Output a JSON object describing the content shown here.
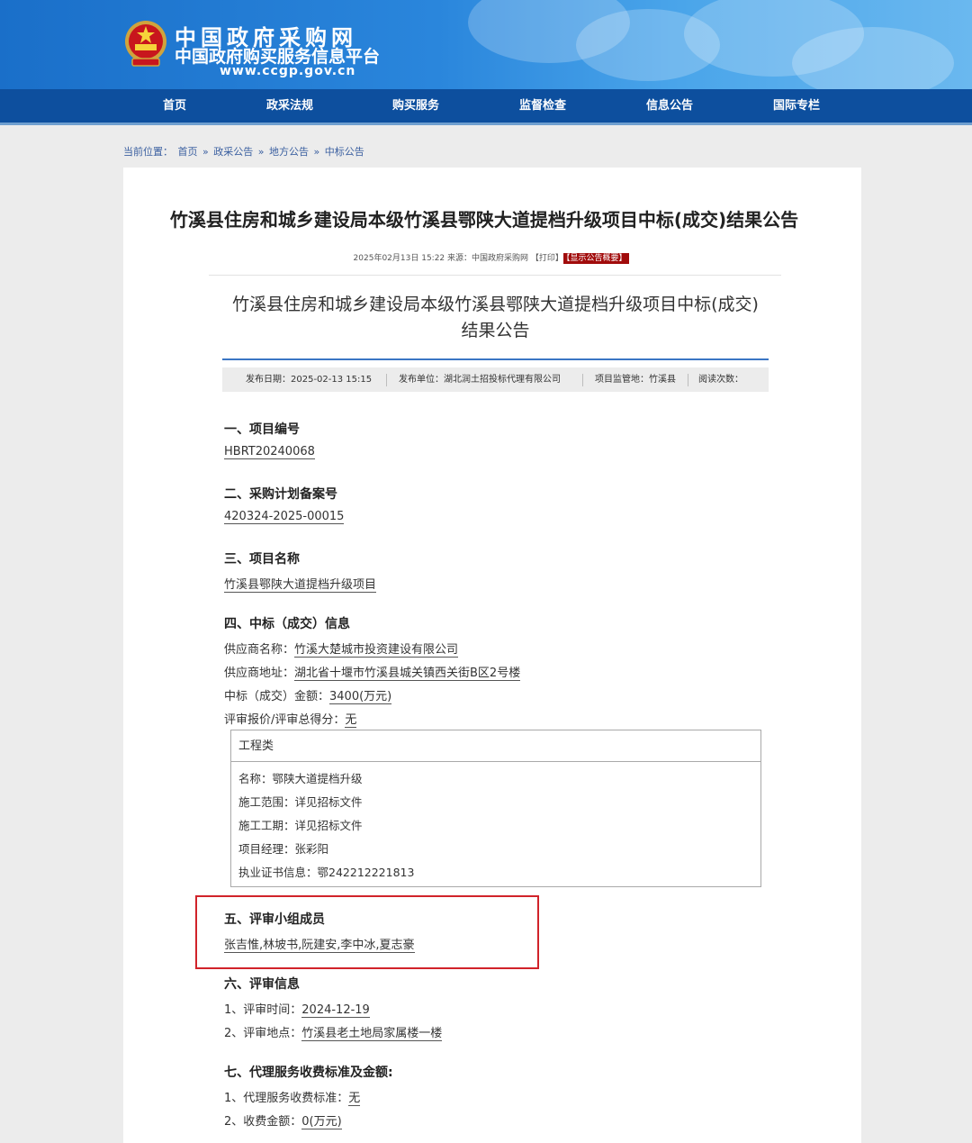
{
  "header": {
    "title": "中国政府采购网",
    "subtitle": "中国政府购买服务信息平台",
    "url": "www.ccgp.gov.cn"
  },
  "nav": [
    "首页",
    "政采法规",
    "购买服务",
    "监督检查",
    "信息公告",
    "国际专栏"
  ],
  "breadcrumb": {
    "prefix": "当前位置：",
    "items": [
      "首页",
      "政采公告",
      "地方公告",
      "中标公告"
    ],
    "sep": "»"
  },
  "page_title": "竹溪县住房和城乡建设局本级竹溪县鄂陕大道提档升级项目中标(成交)结果公告",
  "meta": {
    "datetime": "2025年02月13日 15:22",
    "source": "来源：中国政府采购网",
    "print": "【打印】",
    "summary": "【显示公告概要】"
  },
  "doc": {
    "title_line1": "竹溪县住房和城乡建设局本级竹溪县鄂陕大道提档升级项目中标(成交)",
    "title_line2": "结果公告",
    "info": {
      "date": "发布日期：2025-02-13 15:15",
      "unit": "发布单位：湖北润土招投标代理有限公司",
      "region": "项目监管地：竹溪县",
      "reads": "阅读次数："
    },
    "s1": {
      "heading": "一、项目编号",
      "value": "HBRT20240068"
    },
    "s2": {
      "heading": "二、采购计划备案号",
      "value": "420324-2025-00015"
    },
    "s3": {
      "heading": "三、项目名称",
      "value": "竹溪县鄂陕大道提档升级项目"
    },
    "s4": {
      "heading": "四、中标（成交）信息",
      "supplier_label": "供应商名称：",
      "supplier": "竹溪大楚城市投资建设有限公司",
      "address_label": "供应商地址：",
      "address": "湖北省十堰市竹溪县城关镇西关街B区2号楼",
      "amount_label": "中标（成交）金额：",
      "amount": "3400(万元)",
      "score_label": "评审报价/评审总得分：",
      "score": "无",
      "eng": {
        "head": "工程类",
        "name_label": "名称：",
        "name": "鄂陕大道提档升级",
        "scope_label": "施工范围：",
        "scope": "详见招标文件",
        "period_label": "施工工期：",
        "period": "详见招标文件",
        "manager_label": "项目经理：",
        "manager": "张彩阳",
        "cert_label": "执业证书信息：",
        "cert": "鄂242212221813"
      }
    },
    "s5": {
      "heading": "五、评审小组成员",
      "value": "张吉惟,林坡书,阮建安,李中冰,夏志豪"
    },
    "s6": {
      "heading": "六、评审信息",
      "time_label": "1、评审时间：",
      "time": "2024-12-19",
      "place_label": "2、评审地点：",
      "place": "竹溪县老土地局家属楼一楼"
    },
    "s7": {
      "heading": "七、代理服务收费标准及金额:",
      "std_label": "1、代理服务收费标准：",
      "std": "无",
      "fee_label": "2、收费金额：",
      "fee": "0(万元)"
    }
  }
}
